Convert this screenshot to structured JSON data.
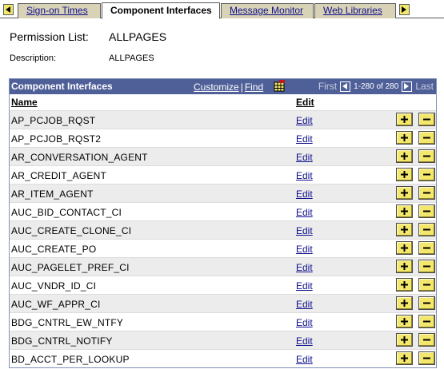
{
  "tabs": {
    "items": [
      {
        "label": "Sign-on Times",
        "active": false
      },
      {
        "label": "Component Interfaces",
        "active": true
      },
      {
        "label": "Message Monitor",
        "active": false
      },
      {
        "label": "Web Libraries",
        "active": false
      }
    ]
  },
  "header": {
    "permission_label": "Permission List:",
    "permission_value": "ALLPAGES",
    "description_label": "Description:",
    "description_value": "ALLPAGES"
  },
  "grid": {
    "title": "Component Interfaces",
    "customize_label": "Customize",
    "separator": "|",
    "find_label": "Find",
    "first_label": "First",
    "count_label": "1-280 of 280",
    "last_label": "Last",
    "col_name": "Name",
    "col_edit": "Edit",
    "edit_link": "Edit",
    "rows": [
      "AP_PCJOB_RQST",
      "AP_PCJOB_RQST2",
      "AR_CONVERSATION_AGENT",
      "AR_CREDIT_AGENT",
      "AR_ITEM_AGENT",
      "AUC_BID_CONTACT_CI",
      "AUC_CREATE_CLONE_CI",
      "AUC_CREATE_PO",
      "AUC_PAGELET_PREF_CI",
      "AUC_VNDR_ID_CI",
      "AUC_WF_APPR_CI",
      "BDG_CNTRL_EW_NTFY",
      "BDG_CNTRL_NOTIFY",
      "BD_ACCT_PER_LOOKUP"
    ]
  },
  "colors": {
    "grid_header": "#4f5f98",
    "button_yellow": "#f4e86c",
    "link": "#10108c"
  }
}
